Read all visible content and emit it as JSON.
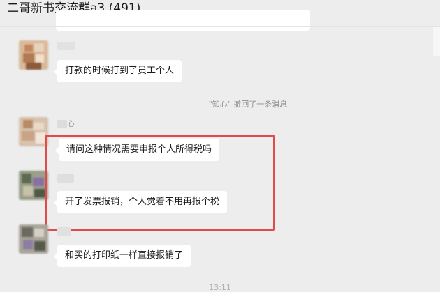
{
  "header": {
    "title": "二哥新书交流群a3 (491)"
  },
  "messages": [
    {
      "sender": "",
      "text": "打款的时候打到了员工个人"
    },
    {
      "sender": "心",
      "text": "请问这种情况需要申报个人所得税吗"
    },
    {
      "sender": "",
      "text": "开了发票报销，个人觉着不用再报个税"
    },
    {
      "sender": "",
      "text": "和买的打印纸一样直接报销了"
    }
  ],
  "system_notice": "\"知心\" 撤回了一条消息",
  "timestamp": "13:11",
  "colors": {
    "background": "#ededed",
    "bubble": "#ffffff",
    "highlight_border": "#e04a4a",
    "text": "#1a1a1a",
    "system_text": "#8d8d8d"
  }
}
